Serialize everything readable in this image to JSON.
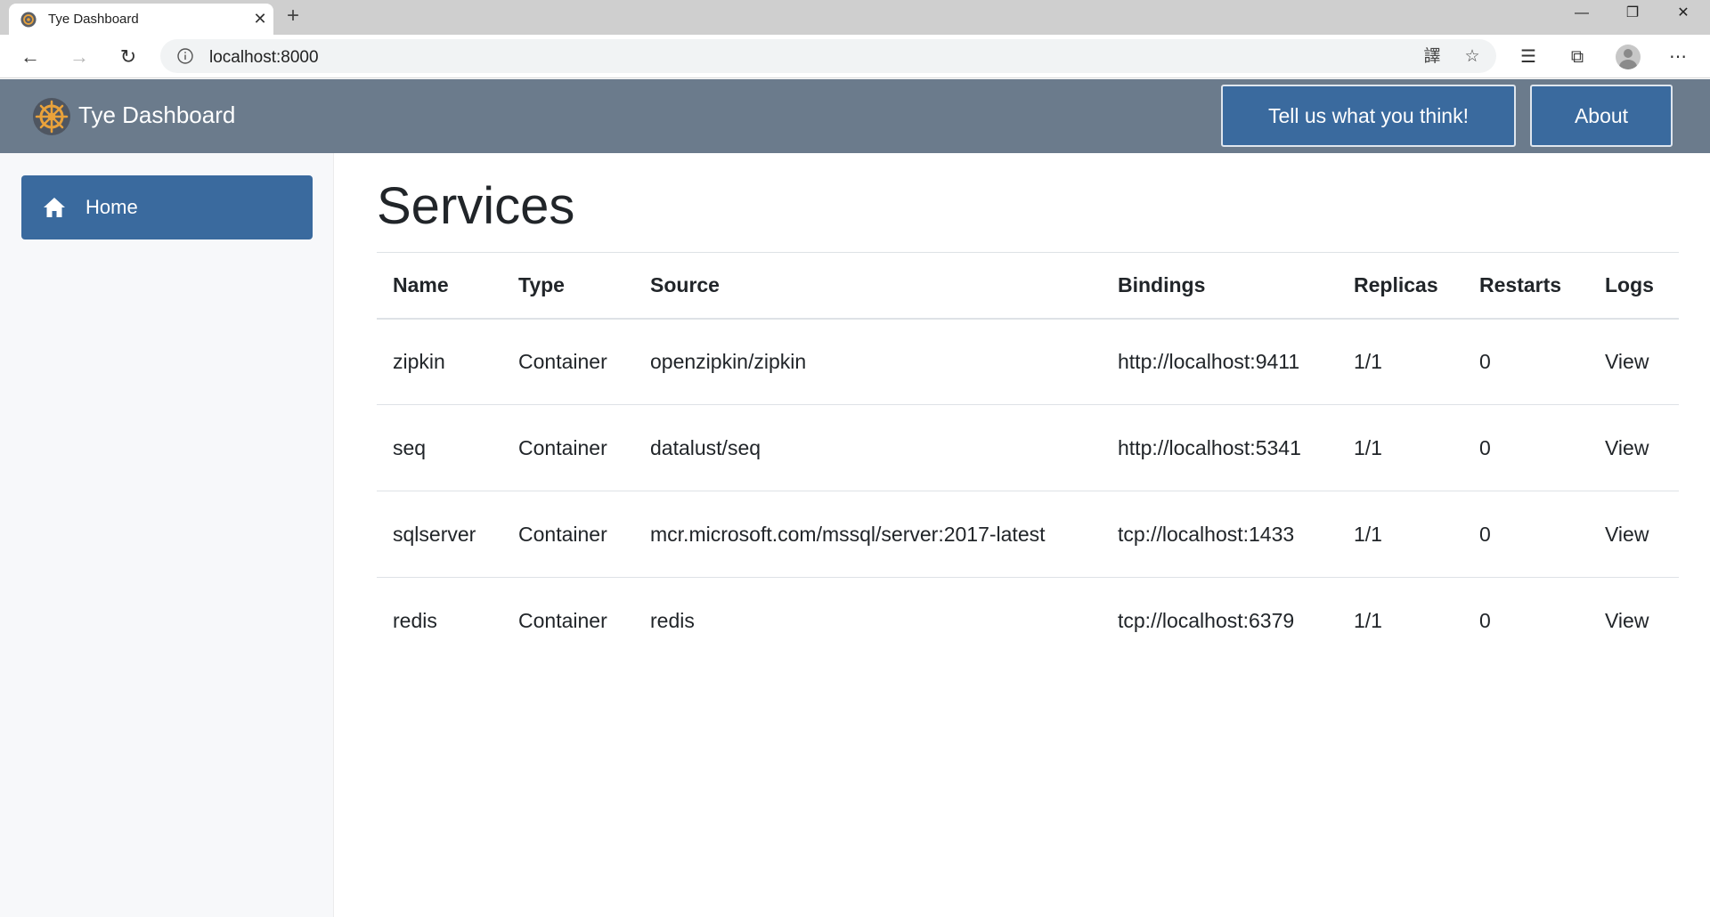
{
  "browser": {
    "tab_title": "Tye Dashboard",
    "tab_close": "✕",
    "new_tab": "+",
    "url": "localhost:8000",
    "window_controls": {
      "minimize": "—",
      "maximize": "❐",
      "close": "✕"
    },
    "icons": {
      "back": "←",
      "forward": "→",
      "reload": "↻",
      "translate": "譯",
      "favorite": "☆",
      "favorites_list": "☰",
      "collections": "⧉",
      "menu": "⋯"
    }
  },
  "header": {
    "title": "Tye Dashboard",
    "feedback_label": "Tell us what you think!",
    "about_label": "About",
    "accent": "#3a6a9e",
    "bar_color": "#6b7b8c"
  },
  "sidebar": {
    "items": [
      {
        "label": "Home",
        "icon": "home-icon",
        "active": true
      }
    ]
  },
  "main": {
    "title": "Services",
    "columns": [
      "Name",
      "Type",
      "Source",
      "Bindings",
      "Replicas",
      "Restarts",
      "Logs"
    ],
    "rows": [
      {
        "name": "zipkin",
        "type": "Container",
        "source": "openzipkin/zipkin",
        "binding": "http://localhost:9411",
        "binding_link": true,
        "replicas": "1/1",
        "restarts": "0",
        "logs": "View"
      },
      {
        "name": "seq",
        "type": "Container",
        "source": "datalust/seq",
        "binding": "http://localhost:5341",
        "binding_link": true,
        "replicas": "1/1",
        "restarts": "0",
        "logs": "View"
      },
      {
        "name": "sqlserver",
        "type": "Container",
        "source": "mcr.microsoft.com/mssql/server:2017-latest",
        "binding": "tcp://localhost:1433",
        "binding_link": false,
        "replicas": "1/1",
        "restarts": "0",
        "logs": "View"
      },
      {
        "name": "redis",
        "type": "Container",
        "source": "redis",
        "binding": "tcp://localhost:6379",
        "binding_link": false,
        "replicas": "1/1",
        "restarts": "0",
        "logs": "View"
      }
    ],
    "link_color": "#2ea3e0"
  }
}
